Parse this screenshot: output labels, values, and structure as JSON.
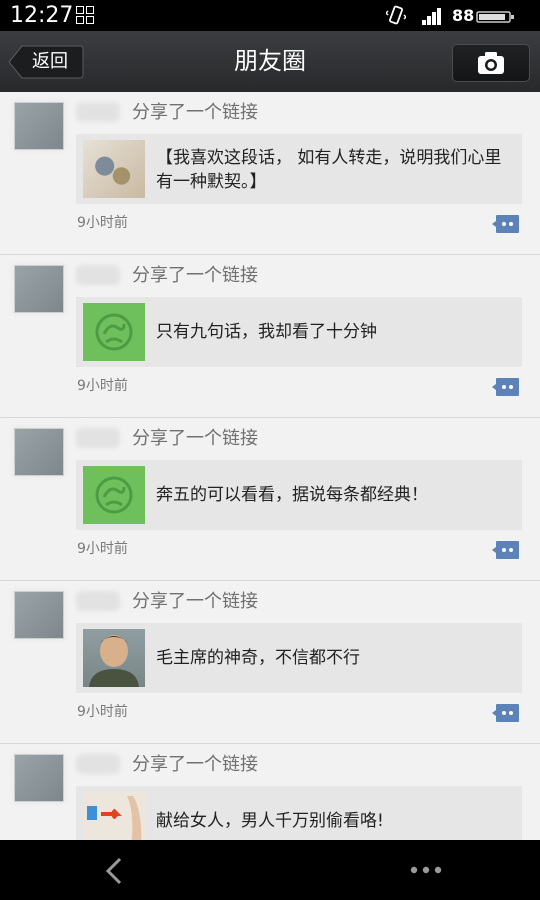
{
  "status_bar": {
    "time": "12:27",
    "battery": "88"
  },
  "title_bar": {
    "back_label": "返回",
    "title": "朋友圈"
  },
  "posts": [
    {
      "action": "分享了一个链接",
      "link_text": "【我喜欢这段话， 如有人转走，说明我们心里有一种默契。】",
      "time": "9小时前",
      "thumbnail": "flower-image"
    },
    {
      "action": "分享了一个链接",
      "link_text": "只有九句话，我却看了十分钟",
      "time": "9小时前",
      "thumbnail": "green-link-icon"
    },
    {
      "action": "分享了一个链接",
      "link_text": "奔五的可以看看，据说每条都经典！",
      "time": "9小时前",
      "thumbnail": "green-link-icon"
    },
    {
      "action": "分享了一个链接",
      "link_text": "毛主席的神奇，不信都不行",
      "time": "9小时前",
      "thumbnail": "portrait-image"
    },
    {
      "action": "分享了一个链接",
      "link_text": "献给女人，男人千万别偷看咯!",
      "time": "",
      "thumbnail": "woman-image"
    }
  ],
  "icons": {
    "camera": "camera-icon",
    "comment": "comment-icon",
    "nav_back": "chevron-left-icon",
    "nav_more": "more-icon"
  },
  "colors": {
    "title_bar": "#333537",
    "feed_bg": "#f2f2f2",
    "card_bg": "#e6e6e6",
    "comment_icon": "#5d82b8"
  }
}
